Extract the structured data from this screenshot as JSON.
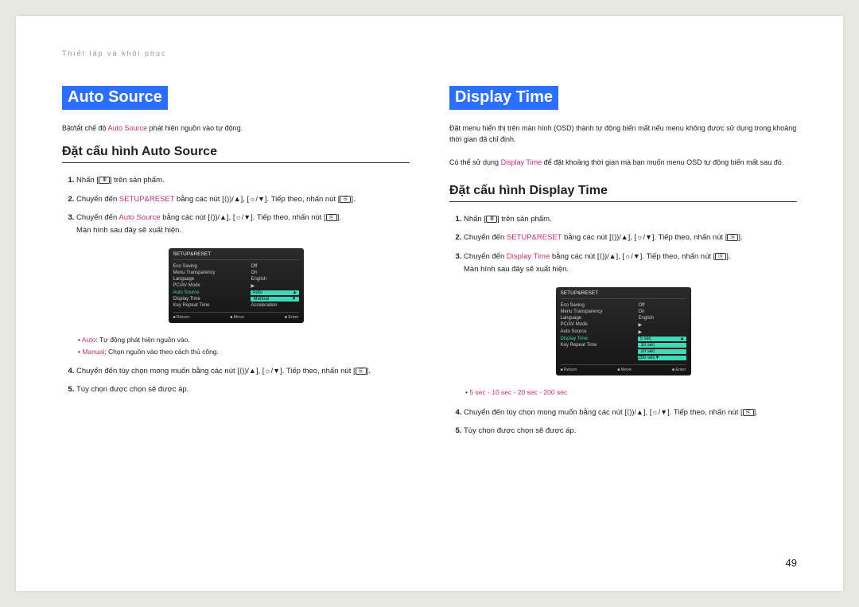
{
  "header": "Thiết lập và khôi phục",
  "page_number": "49",
  "left": {
    "title": "Auto Source",
    "intro": {
      "pre": "Bật/tắt chế độ ",
      "kw": "Auto Source",
      "post": " phát hiện nguồn vào tự động."
    },
    "subhead": "Đặt cấu hình Auto Source",
    "steps": {
      "s1": {
        "a": "Nhấn [",
        "b": "] trên sản phẩm."
      },
      "s2": {
        "a": "Chuyển đến ",
        "kw": "SETUP&RESET",
        "b": " bằng các nút [",
        "mid": "], [",
        "c": "]. Tiếp theo, nhấn nút [",
        "d": "]."
      },
      "s3": {
        "a": "Chuyển đến ",
        "kw": "Auto Source",
        "b": " bằng các nút [",
        "mid": "], [",
        "c": "]. Tiếp theo, nhấn nút [",
        "d": "].",
        "note": "Màn hình sau đây sẽ xuất hiện."
      },
      "s4": {
        "a": "Chuyển đến tùy chọn mong muốn bằng các nút [",
        "mid": "], [",
        "c": "]. Tiếp theo, nhấn nút [",
        "d": "]."
      },
      "s5": "Tùy chọn được chọn sẽ được áp."
    },
    "osd": {
      "title": "SETUP&RESET",
      "rows": [
        {
          "lab": "Eco Saving",
          "val": "Off"
        },
        {
          "lab": "Menu Transparency",
          "val": "On"
        },
        {
          "lab": "Language",
          "val": "English"
        },
        {
          "lab": "PC/AV Mode",
          "val": ""
        },
        {
          "lab": "Auto Source",
          "val": "Auto",
          "hl": true,
          "row2": "Manual"
        },
        {
          "lab": "Display Time",
          "val": ""
        },
        {
          "lab": "Key Repeat Time",
          "val": "Acceleration"
        }
      ],
      "foot": [
        "Return",
        "Move",
        "Enter"
      ]
    },
    "bullets": [
      {
        "kw": "Auto",
        "rest": ": Tự động phát hiện nguồn vào."
      },
      {
        "kw": "Manual",
        "rest": ": Chọn nguồn vào theo cách thủ công."
      }
    ]
  },
  "right": {
    "title": "Display Time",
    "intro1": "Đặt menu hiển thị trên màn hình (OSD) thành tự động biến mất nếu menu không được sử dụng trong khoảng thời gian đã chỉ định.",
    "intro2": {
      "a": "Có thể sử dụng ",
      "kw": "Display Time",
      "b": " để đặt khoảng thời gian mà bạn muốn menu OSD tự động biến mất sau đó."
    },
    "subhead": "Đặt cấu hình Display Time",
    "steps": {
      "s1": {
        "a": "Nhấn [",
        "b": "] trên sản phẩm."
      },
      "s2": {
        "a": "Chuyển đến ",
        "kw": "SETUP&RESET",
        "b": " bằng các nút [",
        "mid": "], [",
        "c": "]. Tiếp theo, nhấn nút [",
        "d": "]."
      },
      "s3": {
        "a": "Chuyển đến ",
        "kw": "Display Time",
        "b": " bằng các nút [",
        "mid": "], [",
        "c": "]. Tiếp theo, nhấn nút [",
        "d": "].",
        "note": "Màn hình sau đây sẽ xuất hiện."
      },
      "s4": {
        "a": "Chuyển đến tùy chọn mong muốn bằng các nút [",
        "mid": "], [",
        "c": "]. Tiếp theo, nhấn nút [",
        "d": "]."
      },
      "s5": "Tùy chọn được chọn sẽ được áp."
    },
    "osd": {
      "title": "SETUP&RESET",
      "rows": [
        {
          "lab": "Eco Saving",
          "val": "Off"
        },
        {
          "lab": "Menu Transparency",
          "val": "On"
        },
        {
          "lab": "Language",
          "val": "English"
        },
        {
          "lab": "PC/AV Mode",
          "val": ""
        },
        {
          "lab": "Auto Source",
          "val": ""
        },
        {
          "lab": "Display Time",
          "val": "5 sec",
          "hl": true,
          "sub": [
            "10 sec",
            "20 sec",
            "200 sec"
          ]
        },
        {
          "lab": "Key Repeat Time",
          "val": ""
        }
      ],
      "foot": [
        "Return",
        "Move",
        "Enter"
      ]
    },
    "bullets_line": "5 sec - 10 sec - 20 sec - 200 sec"
  }
}
